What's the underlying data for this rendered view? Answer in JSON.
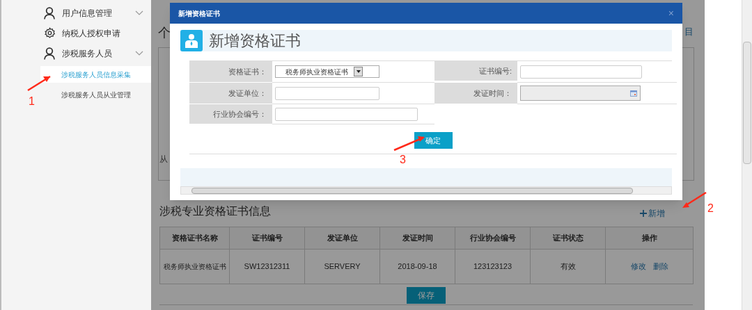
{
  "sidebar": {
    "items": [
      {
        "kind": "group",
        "label": "用户信息管理"
      },
      {
        "kind": "link",
        "label": "纳税人授权申请"
      },
      {
        "kind": "group",
        "label": "涉税服务人员",
        "children": [
          {
            "label": "涉税服务人员信息采集",
            "selected": true
          },
          {
            "label": "涉税服务人员从业管理",
            "selected": false
          }
        ]
      }
    ]
  },
  "background": {
    "heading": "个",
    "row_label": "从",
    "corner_text": "目"
  },
  "certificates": {
    "title": "涉税专业资格证书信息",
    "add_link": "新增",
    "columns": [
      "资格证书名称",
      "证书编号",
      "发证单位",
      "发证时间",
      "行业协会编号",
      "证书状态",
      "操作"
    ],
    "rows": [
      {
        "cells": [
          "税务师执业资格证书",
          "SW12312311",
          "SERVERY",
          "2018-09-18",
          "123123123",
          "有效"
        ],
        "actions": [
          "修改",
          "删除"
        ]
      }
    ],
    "save_button": "保存"
  },
  "modal": {
    "title": "新增资格证书",
    "close": "×",
    "heading": "新增资格证书",
    "fields": [
      {
        "kind": "select",
        "label": "资格证书：",
        "value": "税务师执业资格证书"
      },
      {
        "kind": "text",
        "label": "证书编号:"
      },
      {
        "kind": "text",
        "label": "发证单位："
      },
      {
        "kind": "date",
        "label": "发证时间：",
        "disabled": true
      },
      {
        "kind": "text",
        "label": "行业协会编号："
      }
    ],
    "confirm_button": "确定"
  },
  "annotations": [
    {
      "text": "1"
    },
    {
      "text": "2"
    },
    {
      "text": "3"
    }
  ]
}
